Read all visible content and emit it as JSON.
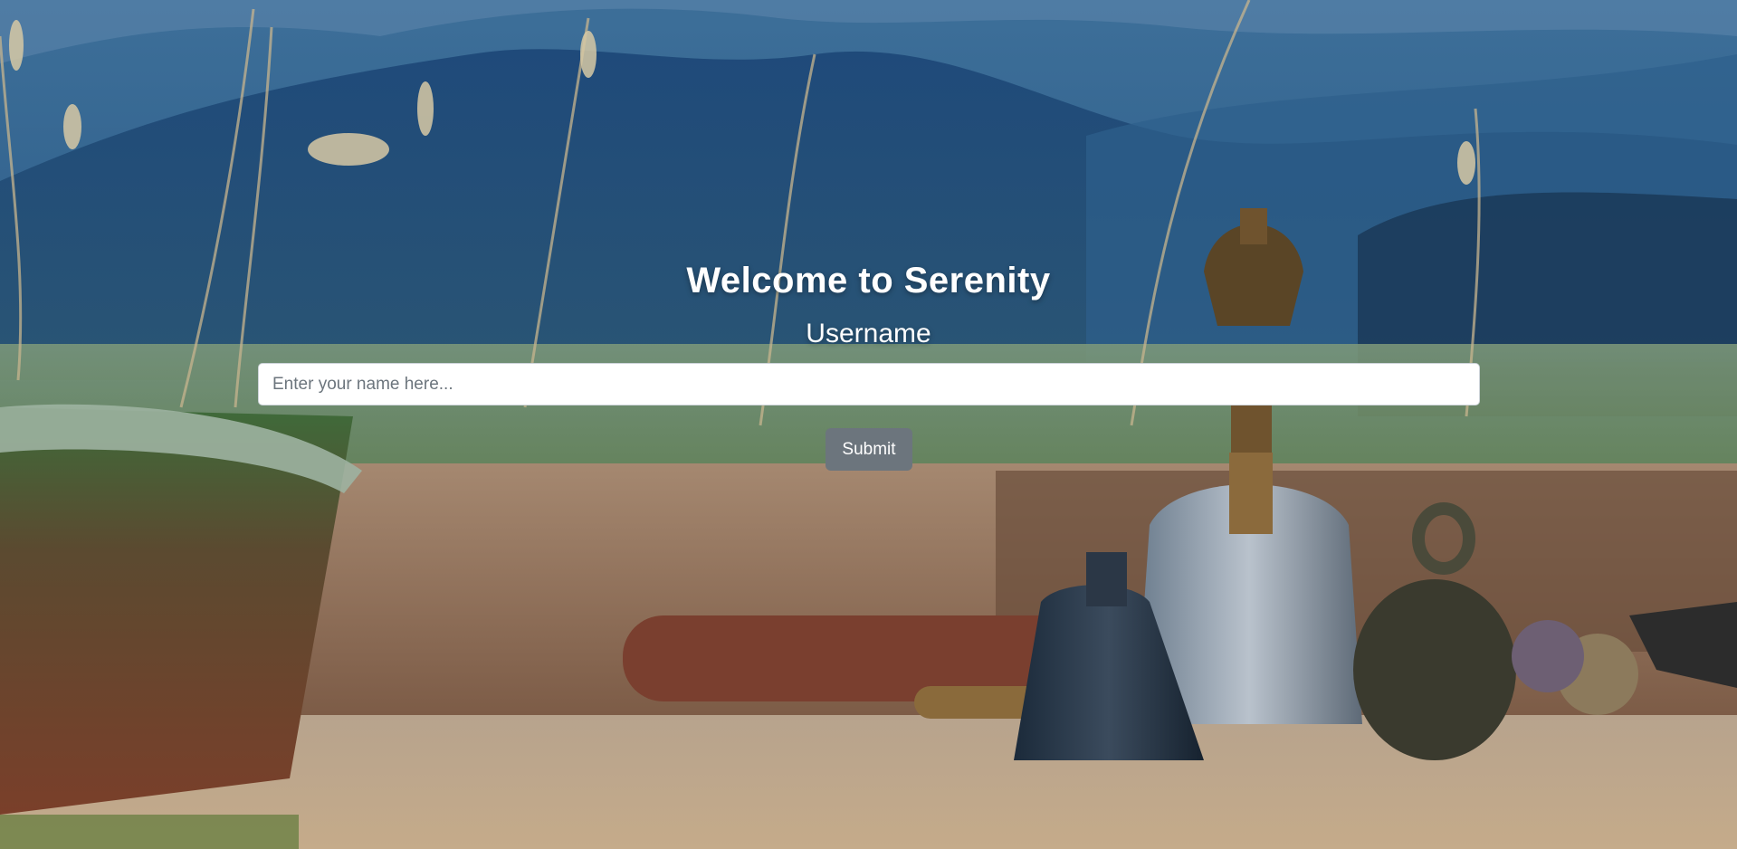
{
  "page": {
    "title": "Welcome to Serenity",
    "username_label": "Username"
  },
  "form": {
    "name_placeholder": "Enter your name here...",
    "name_value": "",
    "submit_label": "Submit"
  },
  "colors": {
    "button": "#6c757d",
    "input_bg": "#ffffff",
    "text": "#ffffff"
  },
  "background": {
    "description_icon": "landscape-photo"
  }
}
